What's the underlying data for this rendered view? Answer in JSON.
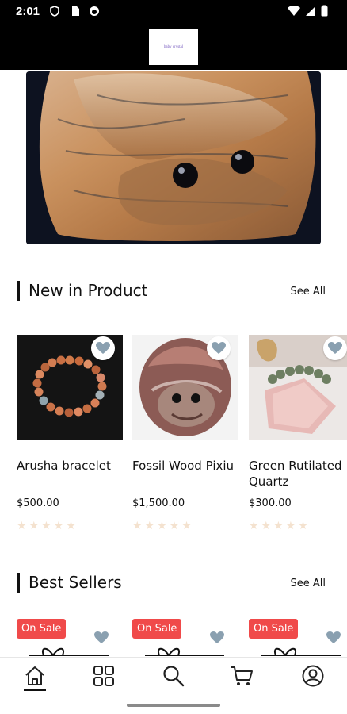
{
  "status_bar": {
    "time": "2:01"
  },
  "header": {
    "logo_text": "baby crystal"
  },
  "new_in": {
    "title": "New in Product",
    "see_all": "See All",
    "products": [
      {
        "name": "Arusha bracelet",
        "price": "$500.00",
        "rating": 0
      },
      {
        "name": "Fossil Wood Pixiu",
        "price": "$1,500.00",
        "rating": 0
      },
      {
        "name": "Green Rutilated Quartz",
        "price": "$300.00",
        "rating": 0
      }
    ]
  },
  "best_sellers": {
    "title": "Best Sellers",
    "see_all": "See All",
    "badges": [
      "On Sale",
      "On Sale",
      "On Sale"
    ]
  },
  "nav": {
    "items": [
      "home-icon",
      "categories-icon",
      "search-icon",
      "cart-icon",
      "profile-icon"
    ],
    "active": "home-icon"
  },
  "colors": {
    "sale_badge": "#f04a4a",
    "heart": "#8aa0b0",
    "star_empty": "#f4e2cf"
  }
}
